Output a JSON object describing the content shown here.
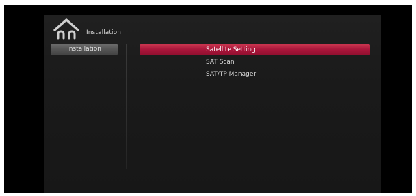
{
  "header": {
    "icon": "home-icon",
    "title": "Installation"
  },
  "sidebar": {
    "items": [
      {
        "label": "Installation",
        "selected": true
      }
    ]
  },
  "menu": {
    "selected_index": 0,
    "items": [
      {
        "label": "Satellite Setting"
      },
      {
        "label": "SAT Scan"
      },
      {
        "label": "SAT/TP Manager"
      }
    ]
  },
  "colors": {
    "highlight": "#a8153a",
    "sidebar_highlight": "#5a5a5a",
    "panel": "#1c1c1c",
    "background": "#000000",
    "text": "#dcdcdc"
  }
}
